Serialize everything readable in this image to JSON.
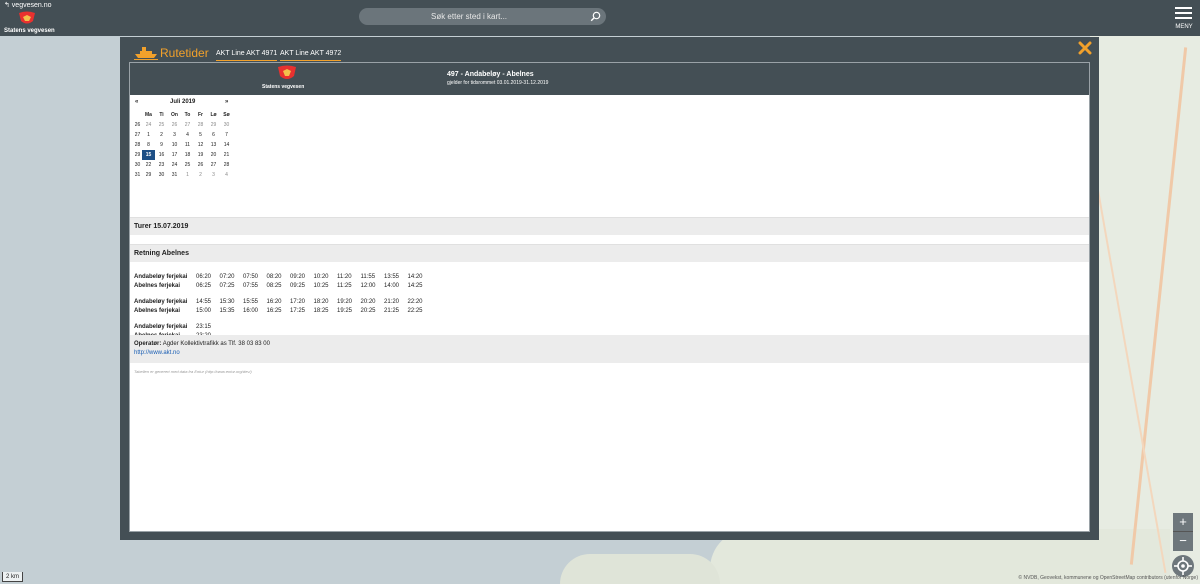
{
  "topbar": {
    "brand_link": "↰ vegvesen.no",
    "brand_name": "Statens vegvesen",
    "search_placeholder": "Søk etter sted i kart...",
    "menu_label": "MENY"
  },
  "modal": {
    "title": "Rutetider",
    "tabs": [
      {
        "label": "AKT Line AKT 4971"
      },
      {
        "label": "AKT Line AKT 4972"
      }
    ],
    "brand_name": "Statens vegvesen",
    "route_title": "497 - Andabeløy - Abelnes",
    "route_valid": "gjelder for tidsrommet 03.01.2019-31.12.2019",
    "calendar": {
      "prev": "«",
      "month": "Juli 2019",
      "next": "»",
      "weekdays": [
        "Ma",
        "Ti",
        "On",
        "To",
        "Fr",
        "Lø",
        "Sø"
      ],
      "weeks": [
        {
          "wk": "26",
          "days": [
            "24",
            "25",
            "26",
            "27",
            "28",
            "29",
            "30"
          ]
        },
        {
          "wk": "27",
          "days": [
            "1",
            "2",
            "3",
            "4",
            "5",
            "6",
            "7"
          ]
        },
        {
          "wk": "28",
          "days": [
            "8",
            "9",
            "10",
            "11",
            "12",
            "13",
            "14"
          ]
        },
        {
          "wk": "29",
          "days": [
            "15",
            "16",
            "17",
            "18",
            "19",
            "20",
            "21"
          ]
        },
        {
          "wk": "30",
          "days": [
            "22",
            "23",
            "24",
            "25",
            "26",
            "27",
            "28"
          ]
        },
        {
          "wk": "31",
          "days": [
            "29",
            "30",
            "31",
            "1",
            "2",
            "3",
            "4"
          ]
        }
      ],
      "selected_day": "15"
    },
    "trips_heading": "Turer 15.07.2019",
    "direction_heading": "Retning Abelnes",
    "schedule_blocks": [
      {
        "rows": [
          {
            "stop": "Andabeløy ferjekai",
            "times": [
              "06:20",
              "07:20",
              "07:50",
              "08:20",
              "09:20",
              "10:20",
              "11:20",
              "11:55",
              "13:55",
              "14:20"
            ]
          },
          {
            "stop": "Abelnes ferjekai",
            "times": [
              "06:25",
              "07:25",
              "07:55",
              "08:25",
              "09:25",
              "10:25",
              "11:25",
              "12:00",
              "14:00",
              "14:25"
            ]
          }
        ]
      },
      {
        "rows": [
          {
            "stop": "Andabeløy ferjekai",
            "times": [
              "14:55",
              "15:30",
              "15:55",
              "16:20",
              "17:20",
              "18:20",
              "19:20",
              "20:20",
              "21:20",
              "22:20"
            ]
          },
          {
            "stop": "Abelnes ferjekai",
            "times": [
              "15:00",
              "15:35",
              "16:00",
              "16:25",
              "17:25",
              "18:25",
              "19:25",
              "20:25",
              "21:25",
              "22:25"
            ]
          }
        ]
      },
      {
        "rows": [
          {
            "stop": "Andabeløy ferjekai",
            "times": [
              "23:15"
            ]
          },
          {
            "stop": "Abelnes ferjekai",
            "times": [
              "23:20"
            ]
          }
        ]
      }
    ],
    "operator_label": "Operatør:",
    "operator_text": "Agder Kollektivtrafikk as Tlf. 38 03 83 00",
    "operator_link": "http://www.akt.no",
    "footnote": "Tabellen er generert med data fra Entur (http://www.entur.org/dev/)"
  },
  "map": {
    "scale": "2 km",
    "zoom_in": "+",
    "zoom_out": "−",
    "attribution": "© NVDB, Geovekst, kommunene og OpenStreetMap contributors (utenfor Norge)"
  },
  "colors": {
    "accent": "#f2a12b",
    "header": "#444f55",
    "selected_day": "#1d4f86",
    "link": "#1b5fb4"
  }
}
